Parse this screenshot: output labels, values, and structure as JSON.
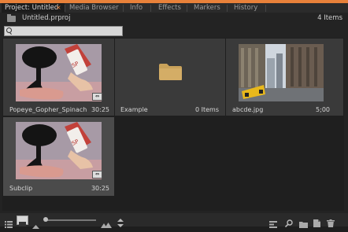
{
  "tabs": [
    {
      "label": "Project: Untitled",
      "active": true
    },
    {
      "label": "Media Browser"
    },
    {
      "label": "Info"
    },
    {
      "label": "Effects"
    },
    {
      "label": "Markers"
    },
    {
      "label": "History"
    }
  ],
  "tab_close": "×",
  "project": {
    "file": "Untitled.prproj",
    "item_count": "4 Items"
  },
  "search": {
    "value": "",
    "placeholder": ""
  },
  "items": [
    {
      "name": "Popeye_Gopher_Spinach...",
      "value": "30:25",
      "kind": "clip",
      "badge": "⇔"
    },
    {
      "name": "Example",
      "value": "0 Items",
      "kind": "bin"
    },
    {
      "name": "abcde.jpg",
      "value": "5;00",
      "kind": "image"
    },
    {
      "name": "Subclip",
      "value": "30:25",
      "kind": "clip",
      "badge": "⇔"
    }
  ],
  "colors": {
    "accent": "#e8813a",
    "folder": "#c9a25a"
  },
  "toolbar_icons": [
    "list-view-icon",
    "icon-view-icon",
    "zoom-small-icon",
    "zoom-slider",
    "zoom-large-icon",
    "sort-icon",
    "automate-icon",
    "find-icon",
    "new-bin-icon",
    "new-item-icon",
    "delete-icon"
  ]
}
